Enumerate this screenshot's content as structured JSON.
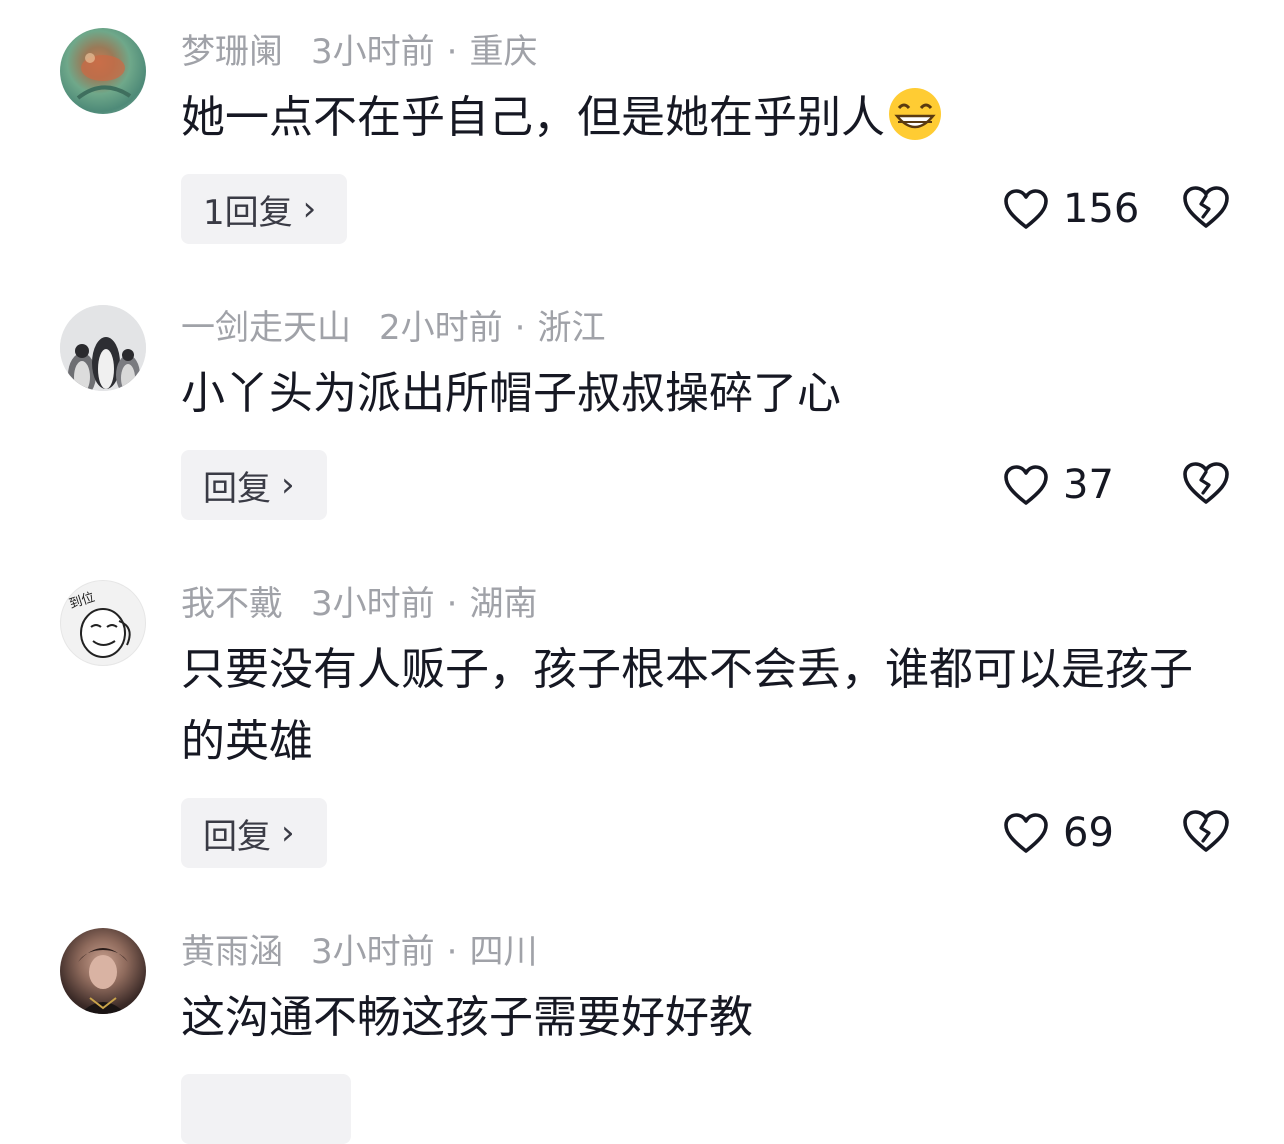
{
  "comments": [
    {
      "username": "梦珊阑",
      "time": "3小时前",
      "location": "重庆",
      "text": "她一点不在乎自己，但是她在乎别人",
      "emoji": "grinning-face-with-smiling-eyes",
      "reply_label": "1回复",
      "likes": "156",
      "avatar_color": "#6fa88a"
    },
    {
      "username": "一剑走天山",
      "time": "2小时前",
      "location": "浙江",
      "text": "小丫头为派出所帽子叔叔操碎了心",
      "reply_label": "回复",
      "likes": "37",
      "avatar_color": "#d9dadc"
    },
    {
      "username": "我不戴",
      "time": "3小时前",
      "location": "湖南",
      "text": "只要没有人贩子，孩子根本不会丢，谁都可以是孩子的英雄",
      "reply_label": "回复",
      "likes": "69",
      "avatar_color": "#f1f1f1",
      "avatar_text": "到位"
    },
    {
      "username": "黄雨涵",
      "time": "3小时前",
      "location": "四川",
      "text": "这沟通不畅这孩子需要好好教",
      "avatar_color": "#6a4d46"
    }
  ],
  "separator": "·"
}
